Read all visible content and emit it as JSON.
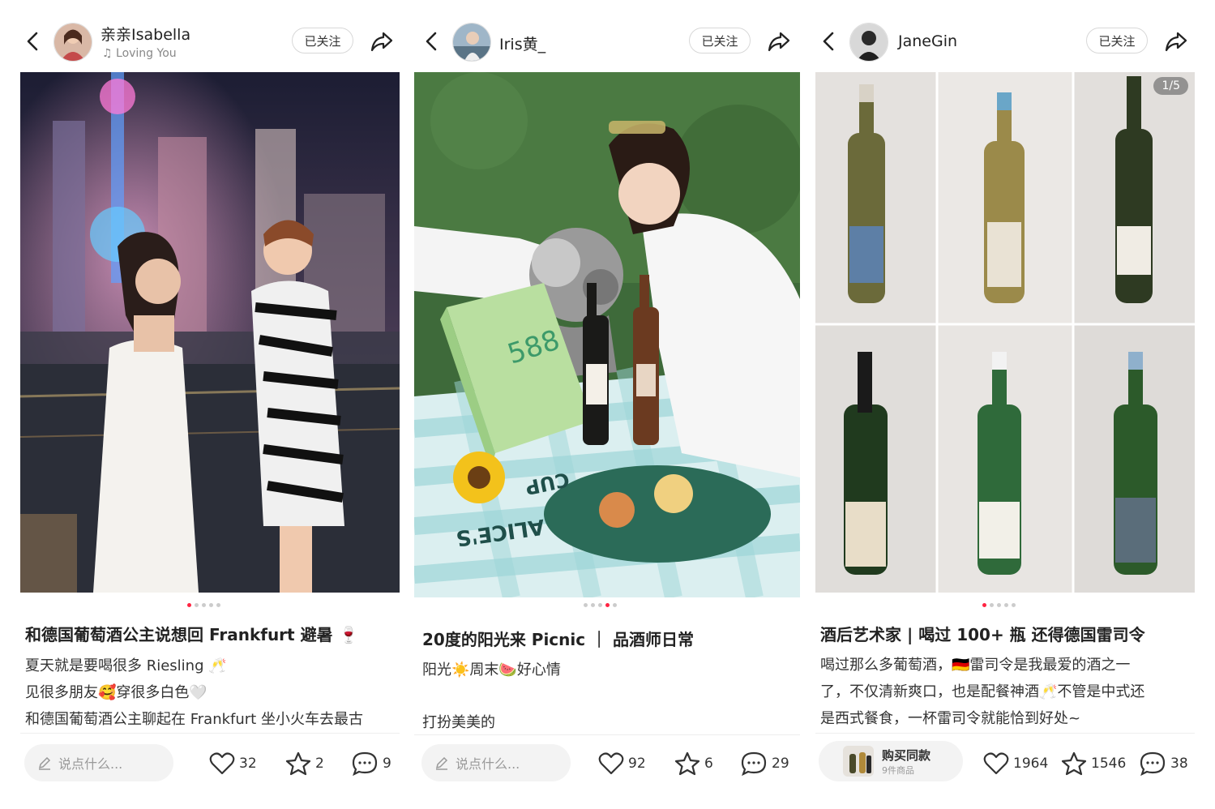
{
  "posts": [
    {
      "username": "亲亲Isabella",
      "music": "Loving You",
      "follow_label": "已关注",
      "title": "和德国葡萄酒公主说想回 Frankfurt 避暑 🍷",
      "lines": [
        "夏天就是要喝很多 Riesling 🥂",
        "见很多朋友🥰穿很多白色🤍",
        "和德国葡萄酒公主聊起在 Frankfurt 坐小火车去最古"
      ],
      "comment_placeholder": "说点什么...",
      "likes": "32",
      "stars": "2",
      "comments": "9"
    },
    {
      "username": "Iris黄_",
      "follow_label": "已关注",
      "title": "20度的阳光来 Picnic ｜ 品酒师日常",
      "lines": [
        "阳光☀️周末🍉好心情",
        "",
        "打扮美美的"
      ],
      "comment_placeholder": "说点什么...",
      "likes": "92",
      "stars": "6",
      "comments": "29",
      "box_text": "588",
      "blanket_text_1": "ALICE'S",
      "blanket_text_2": "CUP"
    },
    {
      "username": "JaneGin",
      "follow_label": "已关注",
      "image_counter": "1/5",
      "title": "酒后艺术家 | 喝过 100+ 瓶 还得德国雷司令",
      "lines": [
        "喝过那么多葡萄酒，🇩🇪雷司令是我最爱的酒之一",
        "了，不仅清新爽口，也是配餐神酒🥂不管是中式还",
        "是西式餐食，一杯雷司令就能恰到好处~"
      ],
      "buy_label": "购买同款",
      "buy_sub": "9件商品",
      "likes": "1964",
      "stars": "1546",
      "comments": "38"
    }
  ],
  "colors": {
    "accent": "#ff2442",
    "text": "#222222",
    "muted": "#999999"
  }
}
